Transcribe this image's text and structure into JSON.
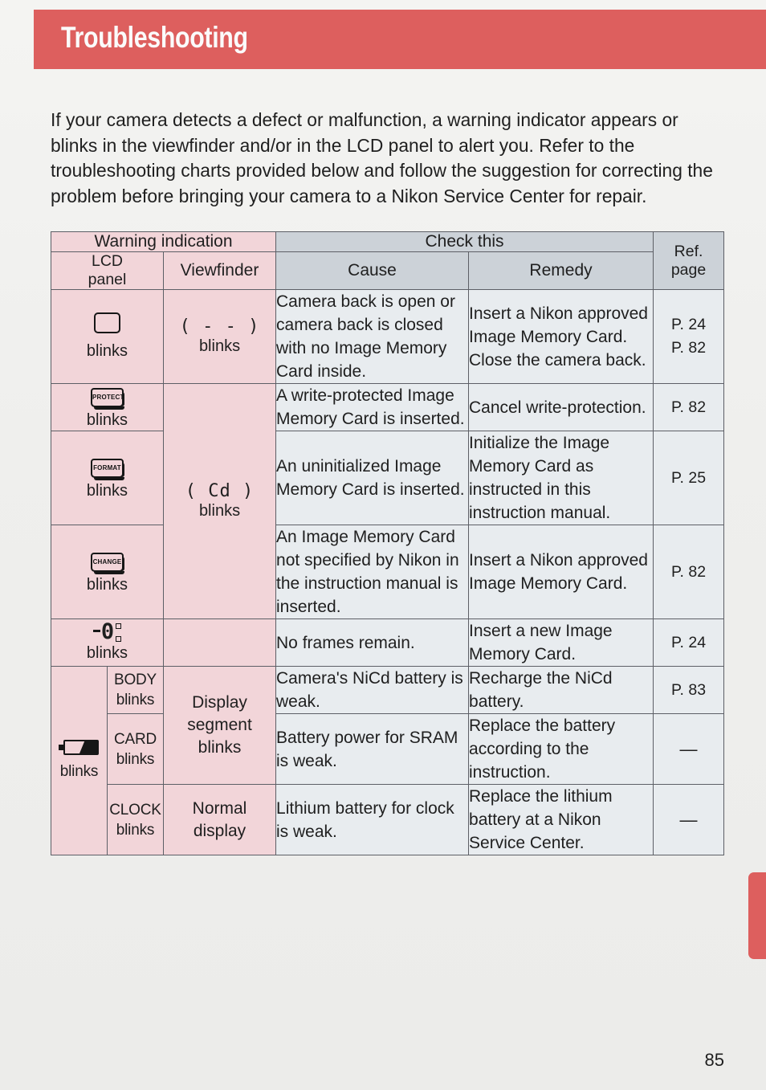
{
  "header": {
    "title": "Troubleshooting",
    "band_color": "#dd5f5e"
  },
  "intro": "If your camera detects a defect or malfunction, a warning indicator appears or blinks in the viewfinder and/or in the LCD panel to alert you. Refer to the troubleshooting charts provided below and follow the suggestion for correcting the problem before bringing your camera to a Nikon Service Center for repair.",
  "page_number": "85",
  "table": {
    "group_headers": {
      "warning_indication": "Warning indication",
      "check_this": "Check this",
      "ref_page": "Ref.\npage",
      "ref_page_line1": "Ref.",
      "ref_page_line2": "page"
    },
    "column_headers": {
      "lcd_panel_line1": "LCD",
      "lcd_panel_line2": "panel",
      "viewfinder": "Viewfinder",
      "cause": "Cause",
      "remedy": "Remedy"
    },
    "rows": [
      {
        "lcd_icon": "card-outline-icon",
        "lcd_icon_label": "",
        "lcd_blinks": "blinks",
        "viewfinder_code": "( - - )",
        "viewfinder_blinks": "blinks",
        "cause": "Camera back is open or camera back is closed with no Image Memory Card inside.",
        "remedy": "Insert a Nikon approved Image Memory Card. Close the camera back.",
        "ref_line1": "P. 24",
        "ref_line2": "P. 82"
      },
      {
        "lcd_icon": "protect-tag-icon",
        "lcd_icon_label": "PROTECT",
        "lcd_blinks": "blinks",
        "cause": "A write-protected Image Memory Card is inserted.",
        "remedy": "Cancel write-protection.",
        "ref_line1": "P. 82",
        "ref_line2": ""
      },
      {
        "lcd_icon": "format-tag-icon",
        "lcd_icon_label": "FORMAT",
        "lcd_blinks": "blinks",
        "cause": "An uninitialized Image Memory Card is inserted.",
        "remedy": "Initialize the Image Memory Card as instructed in this instruction manual.",
        "ref_line1": "P. 25",
        "ref_line2": ""
      },
      {
        "lcd_icon": "change-tag-icon",
        "lcd_icon_label": "CHANGE",
        "lcd_blinks": "blinks",
        "cause": "An Image Memory Card not specified by Nikon in the instruction manual is inserted.",
        "remedy": "Insert a Nikon approved Image Memory Card.",
        "ref_line1": "P. 82",
        "ref_line2": ""
      },
      {
        "lcd_icon": "frame-counter-zero-icon",
        "lcd_icon_label": "0",
        "lcd_blinks": "blinks",
        "cause": "No frames remain.",
        "remedy": "Insert a new Image Memory Card.",
        "ref_line1": "P. 24",
        "ref_line2": ""
      }
    ],
    "merged_viewfinder_middle": {
      "code": "( Cd )",
      "blinks": "blinks"
    },
    "battery_section": {
      "battery_icon": "low-battery-icon",
      "battery_blinks": "blinks",
      "rows": [
        {
          "sub_label": "BODY",
          "sub_blinks": "blinks",
          "cause": "Camera's NiCd battery is weak.",
          "remedy": "Recharge the NiCd battery.",
          "ref": "P. 83"
        },
        {
          "sub_label": "CARD",
          "sub_blinks": "blinks",
          "cause": "Battery power for SRAM is weak.",
          "remedy": "Replace the battery according to the instruction.",
          "ref": "—"
        },
        {
          "sub_label": "CLOCK",
          "sub_blinks": "blinks",
          "cause": "Lithium battery for clock is weak.",
          "remedy": "Replace the lithium battery at a Nikon Service Center.",
          "ref": "—"
        }
      ],
      "viewfinder_display_l1": "Display",
      "viewfinder_display_l2": "segment",
      "viewfinder_display_l3": "blinks",
      "viewfinder_normal_l1": "Normal",
      "viewfinder_normal_l2": "display"
    }
  }
}
